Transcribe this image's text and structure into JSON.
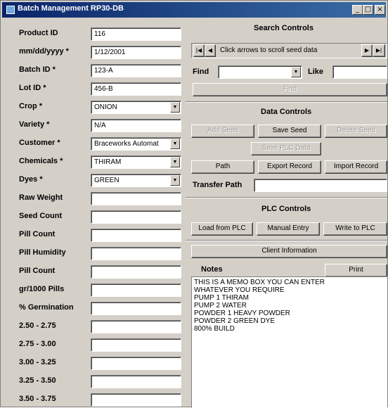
{
  "window": {
    "title": "Batch Management RP30-DB",
    "minimize_glyph": "_",
    "restore_glyph": "□",
    "close_glyph": "×"
  },
  "form": {
    "fields": [
      {
        "label": "Product ID",
        "value": "116",
        "type": "text"
      },
      {
        "label": "mm/dd/yyyy *",
        "value": "1/12/2001",
        "type": "text"
      },
      {
        "label": "Batch ID *",
        "value": "123-A",
        "type": "text"
      },
      {
        "label": "Lot ID *",
        "value": "456-B",
        "type": "text"
      },
      {
        "label": "Crop *",
        "value": "ONION",
        "type": "combo"
      },
      {
        "label": "Variety *",
        "value": "N/A",
        "type": "text"
      },
      {
        "label": "Customer *",
        "value": "Braceworks Automat",
        "type": "combo"
      },
      {
        "label": "Chemicals *",
        "value": "THIRAM",
        "type": "combo"
      },
      {
        "label": "Dyes *",
        "value": "GREEN",
        "type": "combo"
      },
      {
        "label": "Raw Weight",
        "value": "",
        "type": "text"
      },
      {
        "label": "Seed Count",
        "value": "",
        "type": "text"
      },
      {
        "label": "Pill Count",
        "value": "",
        "type": "text"
      },
      {
        "label": "Pill Humidity",
        "value": "",
        "type": "text"
      },
      {
        "label": "Pill Count",
        "value": "",
        "type": "text"
      },
      {
        "label": "gr/1000 Pills",
        "value": "",
        "type": "text"
      },
      {
        "label": "% Germination",
        "value": "",
        "type": "text"
      },
      {
        "label": "2.50 - 2.75",
        "value": "",
        "type": "text"
      },
      {
        "label": "2.75 - 3.00",
        "value": "",
        "type": "text"
      },
      {
        "label": "3.00 - 3.25",
        "value": "",
        "type": "text"
      },
      {
        "label": "3.25 - 3.50",
        "value": "",
        "type": "text"
      },
      {
        "label": "3.50 - 3.75",
        "value": "",
        "type": "text"
      }
    ]
  },
  "search": {
    "title": "Search Controls",
    "nav_text": "Click arrows to scroll seed data",
    "first_glyph": "|◀",
    "prev_glyph": "◀",
    "next_glyph": "▶",
    "last_glyph": "▶|",
    "find_label": "Find",
    "find_value": "",
    "like_label": "Like",
    "like_value": "",
    "find_button": "Find"
  },
  "data_controls": {
    "title": "Data Controls",
    "add_seed": "Add Seed",
    "save_seed": "Save Seed",
    "delete_seed": "Delete Seed",
    "save_plc_data": "Save PLC Data",
    "path": "Path",
    "export_record": "Export Record",
    "import_record": "Import Record",
    "transfer_path_label": "Transfer Path",
    "transfer_path_value": ""
  },
  "plc": {
    "title": "PLC Controls",
    "load_from_plc": "Load from PLC",
    "manual_entry": "Manual Entry",
    "write_to_plc": "Write to PLC",
    "client_information": "Client Information"
  },
  "notes": {
    "label": "Notes",
    "print_button": "Print",
    "lines": [
      "THIS IS A MEMO BOX YOU CAN ENTER",
      "WHATEVER YOU REQUIRE",
      "PUMP 1 THIRAM",
      "PUMP 2 WATER",
      "POWDER 1 HEAVY POWDER",
      "POWDER 2 GREEN DYE",
      "800% BUILD"
    ]
  }
}
